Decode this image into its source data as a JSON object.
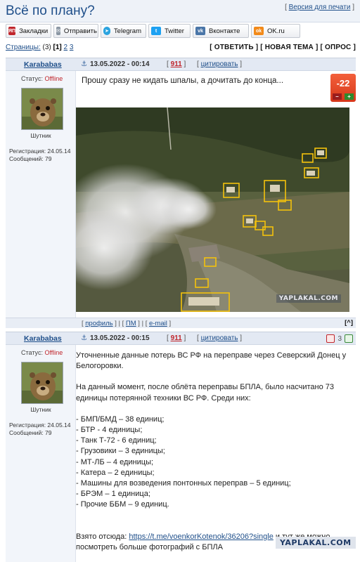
{
  "header": {
    "title": "Всё по плану?",
    "print_version": "Версия для печати"
  },
  "share": [
    {
      "label": "Закладки",
      "icon": "yp-icon",
      "color": "#c0262c",
      "glyph": "ЯП"
    },
    {
      "label": "Отправить",
      "icon": "mail-icon",
      "color": "#7b8794",
      "glyph": "✉"
    },
    {
      "label": "Telegram",
      "icon": "telegram-icon",
      "color": "#2aa3df",
      "glyph": "➤"
    },
    {
      "label": "Twitter",
      "icon": "twitter-icon",
      "color": "#1da1f2",
      "glyph": "t"
    },
    {
      "label": "Вконтакте",
      "icon": "vk-icon",
      "color": "#4a76a8",
      "glyph": "vk"
    },
    {
      "label": "OK.ru",
      "icon": "ok-icon",
      "color": "#f28a1a",
      "glyph": "ok"
    }
  ],
  "pagination": {
    "label": "Страницы:",
    "count": "(3)",
    "current": "[1]",
    "page2": "2",
    "page3": "3",
    "actions": "[ ОТВЕТИТЬ ] [ НОВАЯ ТЕМА ] [ ОПРОС ]"
  },
  "post1": {
    "author": "Karababas",
    "anchor": "⚓",
    "date": "13.05.2022 - 00:14",
    "number": "911",
    "quote": "цитировать",
    "status_label": "Статус: ",
    "status": "Offline",
    "rank": "Шутник",
    "registration": "Регистрация: 24.05.14",
    "messages": "Сообщений: 79",
    "text": "Прошу сразу не кидать шпалы, а дочитать до конца...",
    "rating": "-22",
    "minus": "–",
    "plus": "+",
    "watermark": "YAPLAKAL.COM"
  },
  "footer1": {
    "profile": "профиль",
    "pm": "ПМ",
    "email": "e-mail",
    "up": "[^]"
  },
  "post2": {
    "author": "Karababas",
    "anchor": "⚓",
    "date": "13.05.2022 - 00:15",
    "number": "911",
    "quote": "цитировать",
    "status_label": "Статус: ",
    "status": "Offline",
    "rank": "Шутник",
    "registration": "Регистрация: 24.05.14",
    "messages": "Сообщений: 79",
    "rating": "3",
    "intro": "Уточненные данные потерь ВС РФ на переправе через Северский Донец у Белогоровки.",
    "summary": "На данный момент, после облёта переправы БПЛА, было насчитано 73 единицы потерянной техники ВС РФ. Среди них:",
    "items": [
      "- БМП/БМД – 38 единиц;",
      "- БТР - 4 единицы;",
      "- Танк Т-72 - 6 единиц;",
      "- Грузовики – 3 единицы;",
      "- МТ-ЛБ – 4 единицы;",
      "- Катера – 2 единицы;",
      "- Машины для возведения понтонных переправ – 5 единиц;",
      "- БРЭМ – 1 единица;",
      "- Прочие ББМ – 9 единиц."
    ],
    "source_prefix": "Взято отсюда: ",
    "source_link": "https://t.me/voenkorKotenok/36206?single",
    "source_suffix": " и тут же можно посмотреть больше фотографий с БПЛА",
    "watermark": "YAPLAKAL.COM"
  }
}
